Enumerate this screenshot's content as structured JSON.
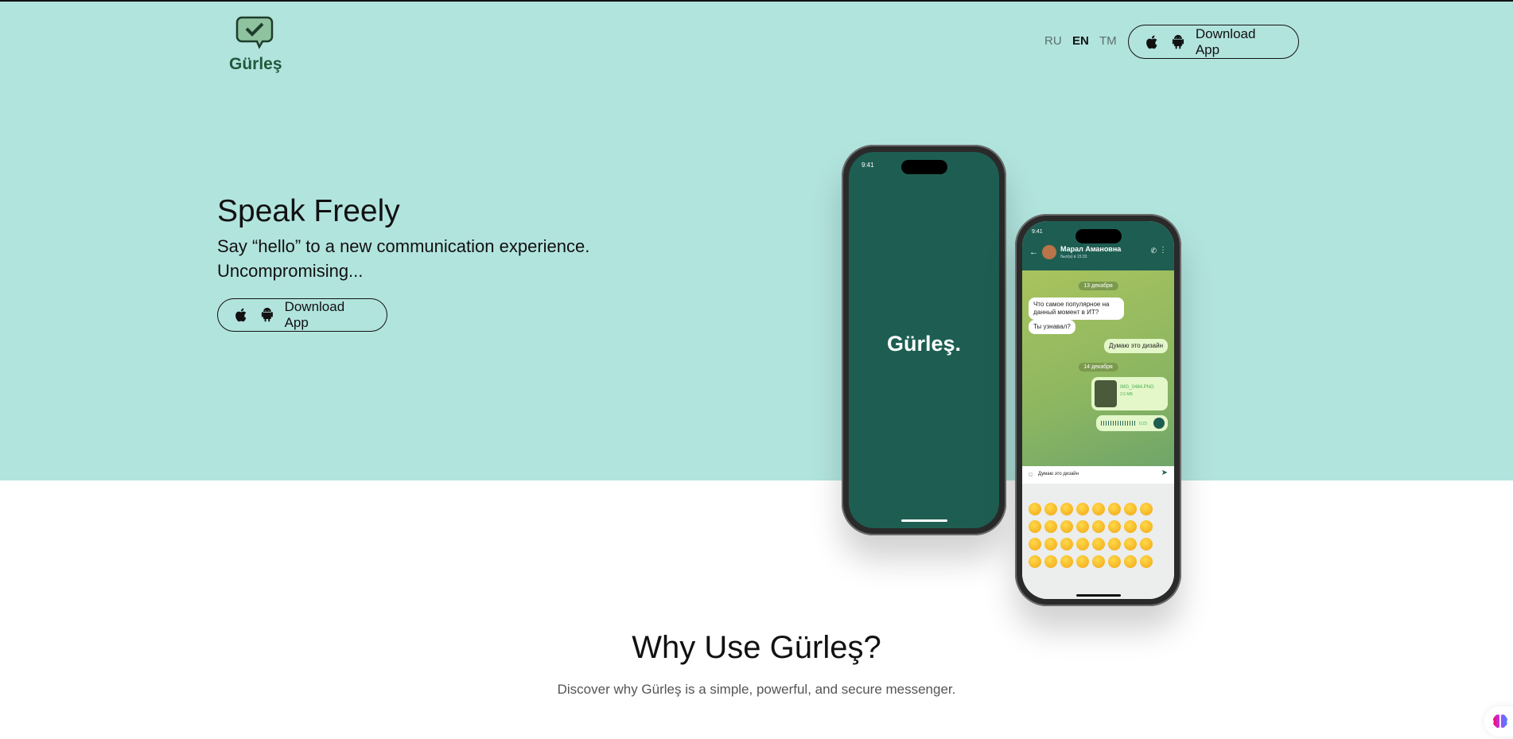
{
  "header": {
    "logo_text": "Gürleş",
    "languages": [
      {
        "label": "RU",
        "active": false
      },
      {
        "label": "EN",
        "active": true
      },
      {
        "label": "TM",
        "active": false
      }
    ],
    "download_label": "Download App"
  },
  "hero": {
    "title": "Speak Freely",
    "subtitle_line1": "Say “hello” to a new communication experience.",
    "subtitle_line2": "Uncompromising...",
    "download_label": "Download App"
  },
  "phone_splash": {
    "time": "9:41",
    "brand": "Gürleş."
  },
  "phone_chat": {
    "time": "9:41",
    "contact_name": "Марал Амановна",
    "contact_status": "был(а) в 15:33",
    "date1": "13 декабря",
    "msg1": "Что самое популярное на данный момент в ИТ?",
    "msg2": "Ты узнавал?",
    "msg3": "Думаю это дизайн",
    "date2": "14 декабря",
    "file_name": "IMG_0484.PNG",
    "file_size": "2.6 MB",
    "voice_duration": "0:23",
    "input_text": "Думаю это дизайн"
  },
  "why": {
    "title": "Why Use Gürleş?",
    "subtitle": "Discover why Gürleş is a simple, powerful, and secure messenger."
  },
  "colors": {
    "hero_bg": "#b2e4de",
    "brand_green": "#1e5e52",
    "logo_green": "#1f5a3d"
  }
}
